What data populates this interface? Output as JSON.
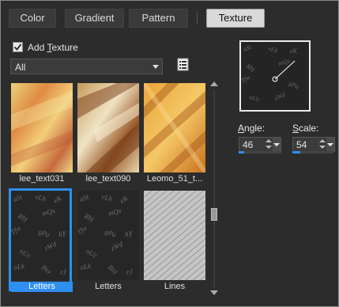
{
  "tabs": [
    {
      "label": "Color",
      "active": false
    },
    {
      "label": "Gradient",
      "active": false
    },
    {
      "label": "Pattern",
      "active": false
    },
    {
      "label": "Texture",
      "active": true
    }
  ],
  "add_texture": {
    "prefix": "Add ",
    "accel": "T",
    "suffix": "exture",
    "checked": true
  },
  "category_select": {
    "value": "All"
  },
  "browse_icon": "texture-browse-icon",
  "textures": [
    {
      "name": "lee_text031",
      "selected": false,
      "swatch": "orange-gradient"
    },
    {
      "name": "lee_text090",
      "selected": false,
      "swatch": "parchment"
    },
    {
      "name": "Leomo_51_t...",
      "selected": false,
      "swatch": "gold-weave"
    },
    {
      "name": "Letters",
      "selected": true,
      "swatch": "letters"
    },
    {
      "name": "Letters",
      "selected": false,
      "swatch": "letters"
    },
    {
      "name": "Lines",
      "selected": false,
      "swatch": "lines"
    }
  ],
  "angle": {
    "label_accel": "A",
    "label_rest": "ngle:",
    "value": "46",
    "level": 0.13
  },
  "scale": {
    "label_accel": "S",
    "label_rest": "cale:",
    "value": "54",
    "level": 0.2
  },
  "colors": {
    "accent": "#2e8ff0",
    "background": "#2c2c2c"
  }
}
